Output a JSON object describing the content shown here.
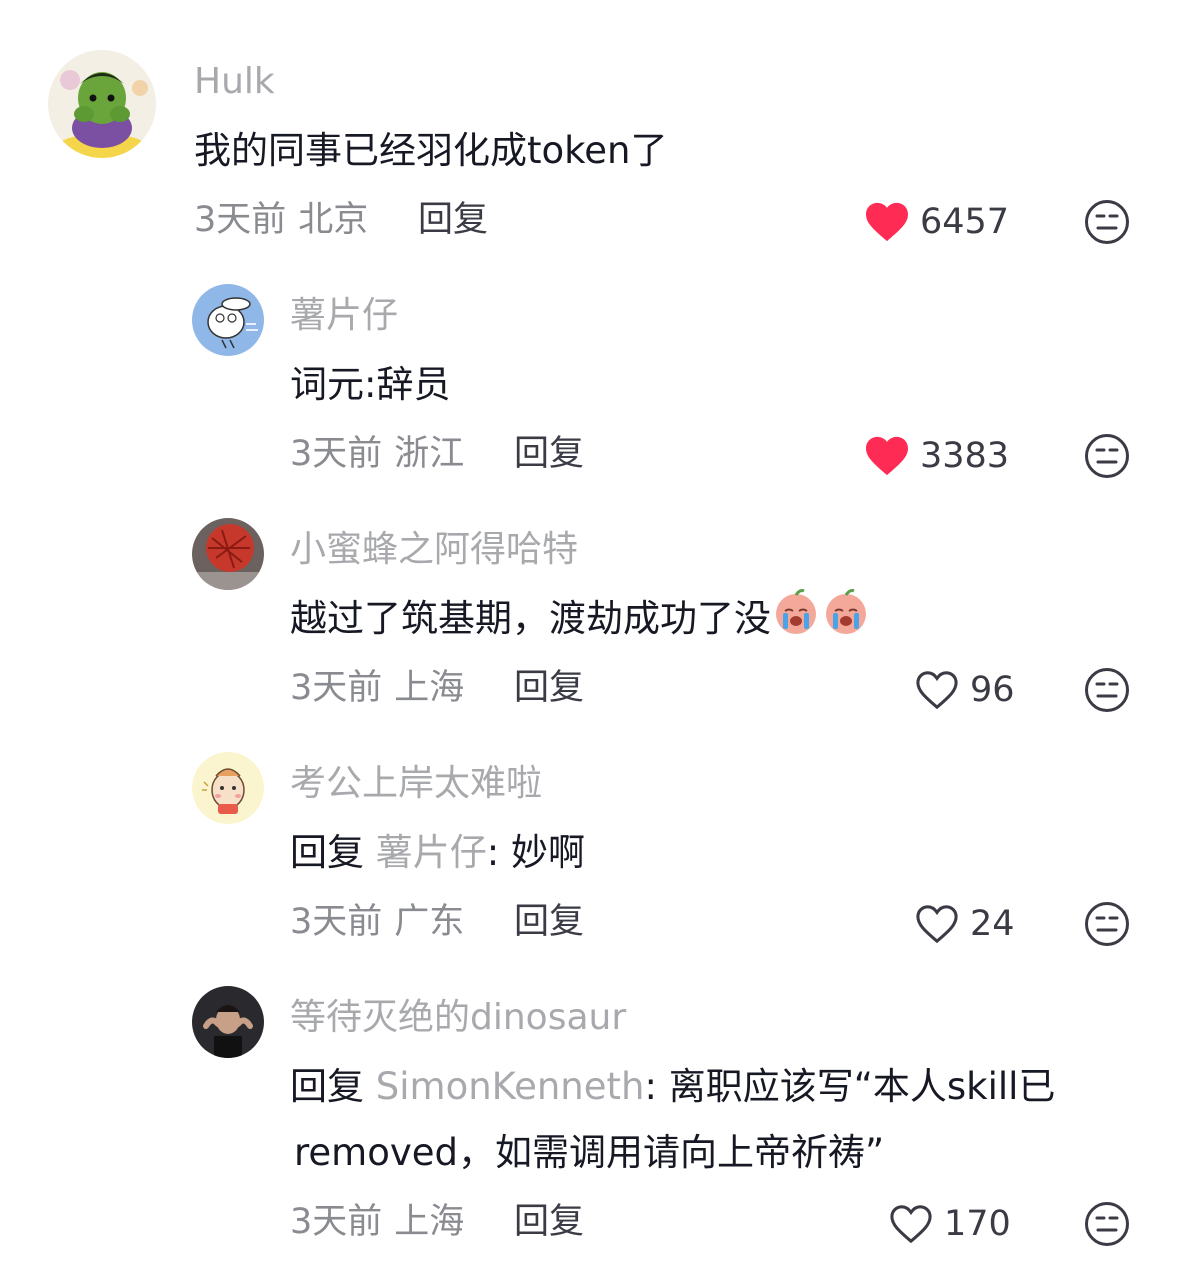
{
  "comments": [
    {
      "username": "Hulk",
      "text": "我的同事已经羽化成token了",
      "time": "3天前",
      "location": "北京",
      "reply_label": "回复",
      "likes": "6457",
      "liked": true,
      "avatar_icon": "hulk-toy-avatar"
    },
    {
      "username": "薯片仔",
      "text": "词元:辞员",
      "time": "3天前",
      "location": "浙江",
      "reply_label": "回复",
      "likes": "3383",
      "liked": true,
      "avatar_icon": "cartoon-rabbit-avatar"
    },
    {
      "username": "小蜜蜂之阿得哈特",
      "text": "越过了筑基期，渡劫成功了没",
      "emojis": [
        "crying-face-emoji",
        "crying-face-emoji"
      ],
      "time": "3天前",
      "location": "上海",
      "reply_label": "回复",
      "likes": "96",
      "liked": false,
      "avatar_icon": "red-branches-avatar"
    },
    {
      "username": "考公上岸太难啦",
      "reply_prefix": "回复",
      "mention": "薯片仔",
      "text": ": 妙啊",
      "time": "3天前",
      "location": "广东",
      "reply_label": "回复",
      "likes": "24",
      "liked": false,
      "avatar_icon": "cartoon-horse-avatar"
    },
    {
      "username": "等待灭绝的dinosaur",
      "reply_prefix": "回复",
      "mention": "SimonKenneth",
      "text_line1": ": 离职应该写“本人skill已",
      "text_line2": "removed，如需调用请向上帝祈祷”",
      "time": "3天前",
      "location": "上海",
      "reply_label": "回复",
      "likes": "170",
      "liked": false,
      "avatar_icon": "man-portrait-avatar"
    }
  ],
  "colors": {
    "like_active": "#fe2c55",
    "username": "#a8a9ad",
    "meta": "#8a8b91",
    "text": "#161823"
  }
}
